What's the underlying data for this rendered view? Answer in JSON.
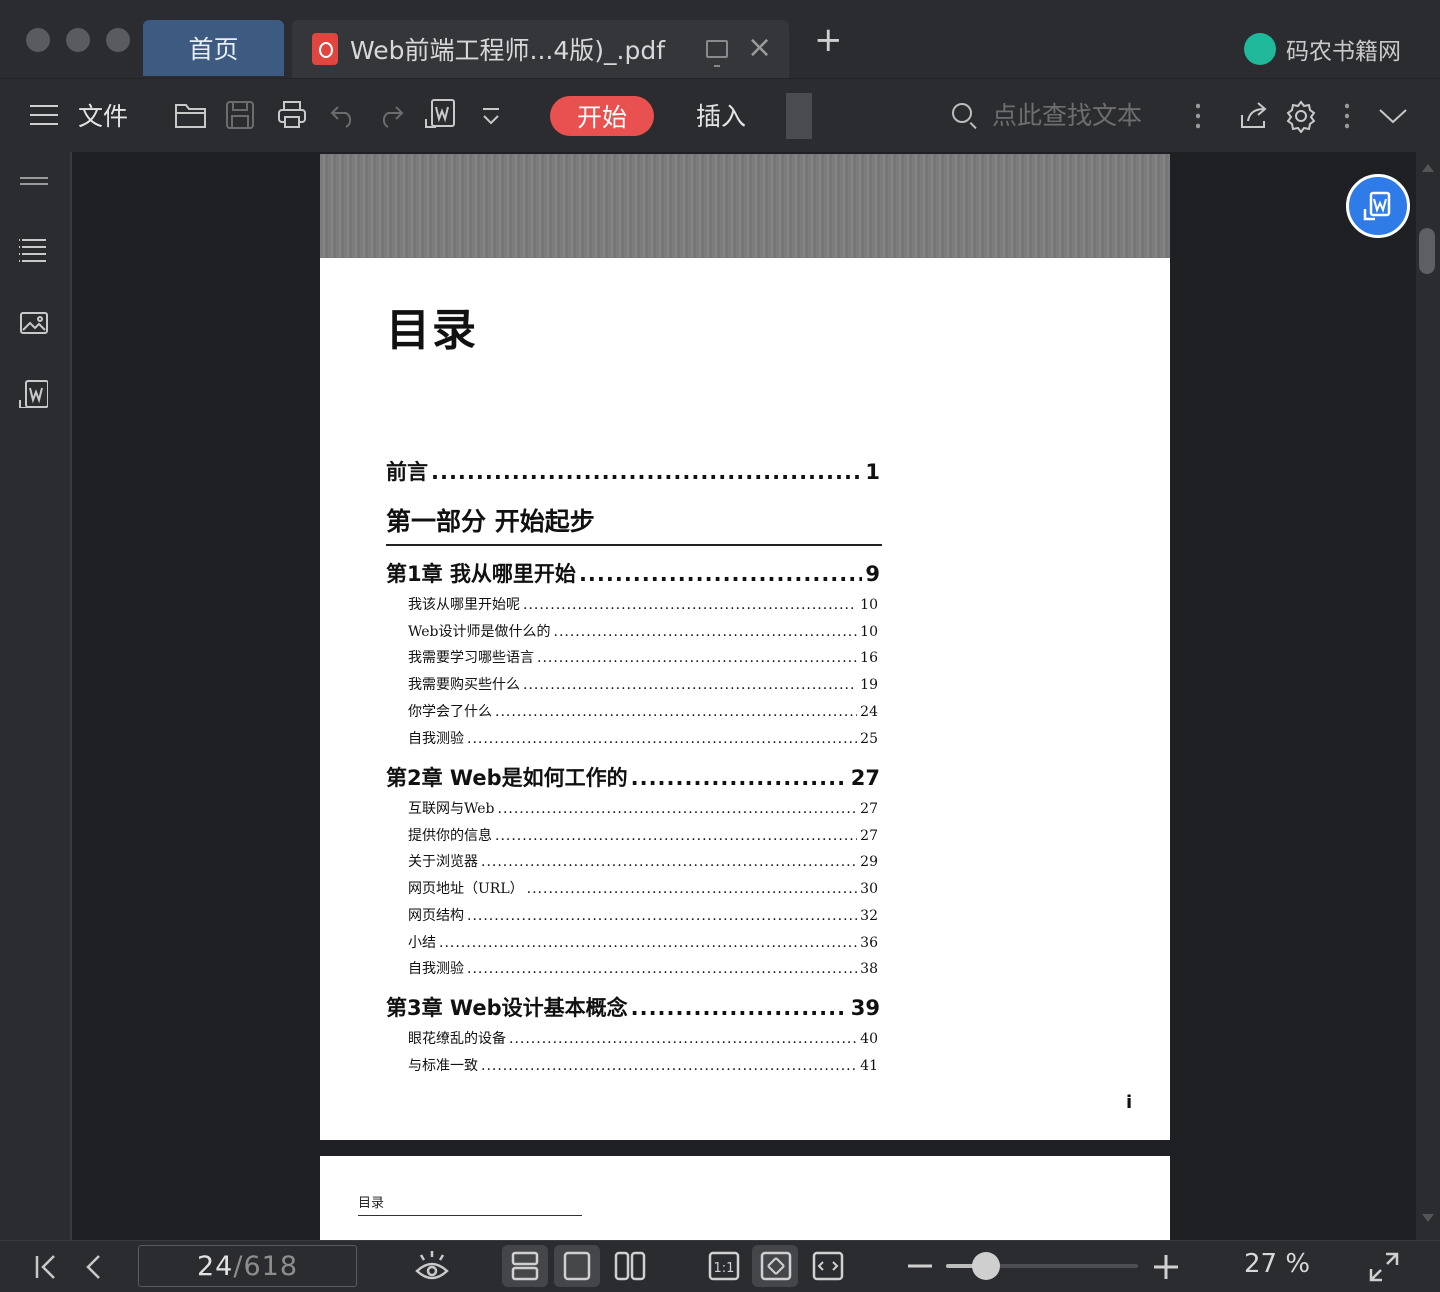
{
  "tabs": {
    "home_label": "首页",
    "doc_title": "Web前端工程师...4版)_.pdf"
  },
  "brand": {
    "name": "码农书籍网"
  },
  "toolbar": {
    "file_label": "文件",
    "start_label": "开始",
    "insert_label": "插入",
    "search_placeholder": "点此查找文本"
  },
  "document": {
    "toc_title": "目录",
    "preface": {
      "label": "前言",
      "page": "1"
    },
    "part1_title": "第一部分  开始起步",
    "chapters": [
      {
        "label": "第1章  我从哪里开始",
        "page": "9",
        "sections": [
          {
            "label": "我该从哪里开始呢",
            "page": "10"
          },
          {
            "label": "Web设计师是做什么的",
            "page": "10"
          },
          {
            "label": "我需要学习哪些语言",
            "page": "16"
          },
          {
            "label": "我需要购买些什么",
            "page": "19"
          },
          {
            "label": "你学会了什么",
            "page": "24"
          },
          {
            "label": "自我测验",
            "page": "25"
          }
        ]
      },
      {
        "label": "第2章  Web是如何工作的",
        "page": "27",
        "sections": [
          {
            "label": "互联网与Web",
            "page": "27"
          },
          {
            "label": "提供你的信息",
            "page": "27"
          },
          {
            "label": "关于浏览器",
            "page": "29"
          },
          {
            "label": "网页地址（URL）",
            "page": "30"
          },
          {
            "label": "网页结构",
            "page": "32"
          },
          {
            "label": "小结",
            "page": "36"
          },
          {
            "label": "自我测验",
            "page": "38"
          }
        ]
      },
      {
        "label": "第3章  Web设计基本概念",
        "page": "39",
        "sections": [
          {
            "label": "眼花缭乱的设备",
            "page": "40"
          },
          {
            "label": "与标准一致",
            "page": "41"
          }
        ]
      }
    ],
    "page_numeral": "i",
    "next_page_header": "目录"
  },
  "bottom": {
    "current_page": "24",
    "total_pages": "/618",
    "zoom_text": "27 %",
    "zoom_fraction": 0.21
  },
  "colors": {
    "accent_start": "#e8514f",
    "home_tab": "#3d5a80",
    "float_button": "#2f7be8"
  }
}
